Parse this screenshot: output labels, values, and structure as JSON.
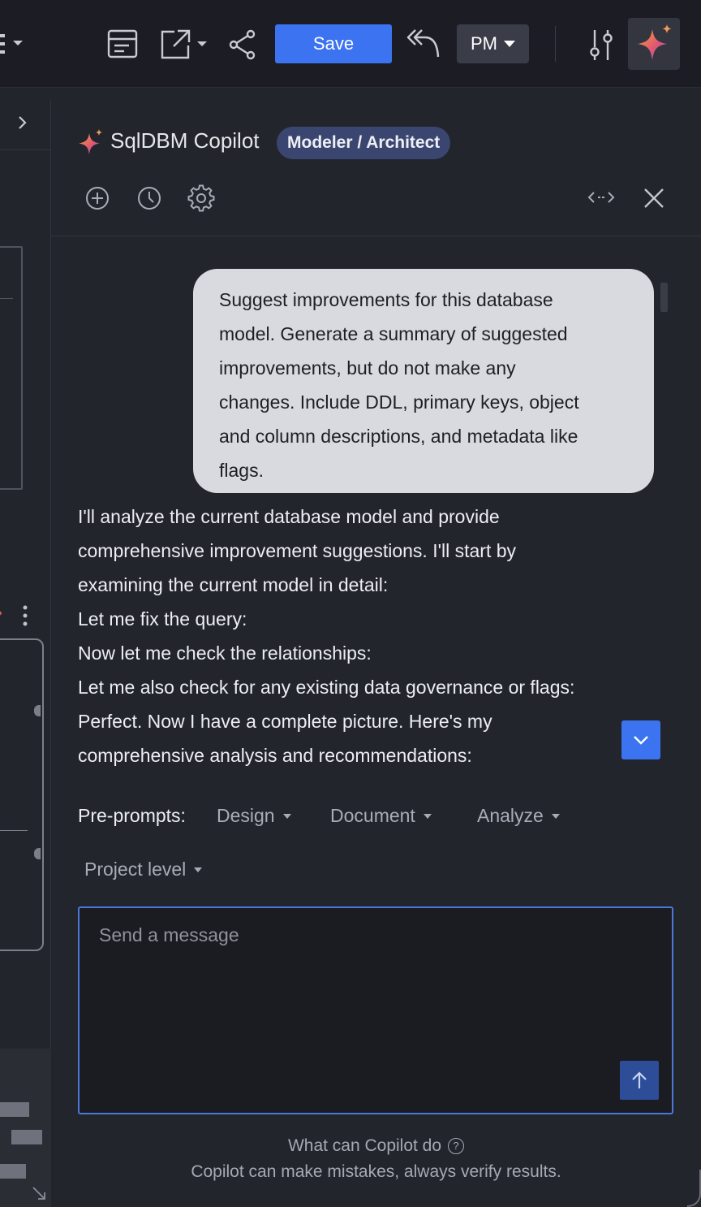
{
  "toolbar": {
    "save_label": "Save",
    "project_initials": "PM"
  },
  "copilot": {
    "title": "SqlDBM Copilot",
    "role_badge": "Modeler / Architect"
  },
  "chat": {
    "user_message_lines": [
      "Suggest improvements for this database",
      "model. Generate a summary of suggested",
      "improvements, but do not make any",
      "changes. Include DDL, primary keys, object",
      "and column descriptions, and metadata like",
      "flags."
    ],
    "assistant_lines": [
      "I'll analyze the current database model and provide",
      "comprehensive improvement suggestions. I'll start by",
      "examining the current model in detail:",
      "Let me fix the query:",
      "Now let me check the relationships:",
      "Let me also check for any existing data governance or flags:",
      "Perfect. Now I have a complete picture. Here's my",
      "comprehensive analysis and recommendations:"
    ]
  },
  "preprompts": {
    "label": "Pre-prompts:",
    "items": [
      "Design",
      "Document",
      "Analyze",
      "Project level"
    ]
  },
  "composer": {
    "placeholder": "Send a message",
    "value": ""
  },
  "footer": {
    "help_link": "What can Copilot do",
    "help_icon": "?",
    "disclaimer": "Copilot can make mistakes, always verify results."
  },
  "colors": {
    "accent": "#3b73f0",
    "badge": "#3a4670",
    "user_bubble": "#d9dadf",
    "panel_bg": "#23252d"
  },
  "icons": [
    "layout-icon",
    "export-icon",
    "share-icon",
    "reply-all-icon",
    "sliders-icon",
    "sparkle-icon",
    "plus-circle-icon",
    "history-icon",
    "gear-icon",
    "expand-horizontal-icon",
    "close-icon",
    "chevron-down-icon",
    "arrow-up-icon"
  ]
}
